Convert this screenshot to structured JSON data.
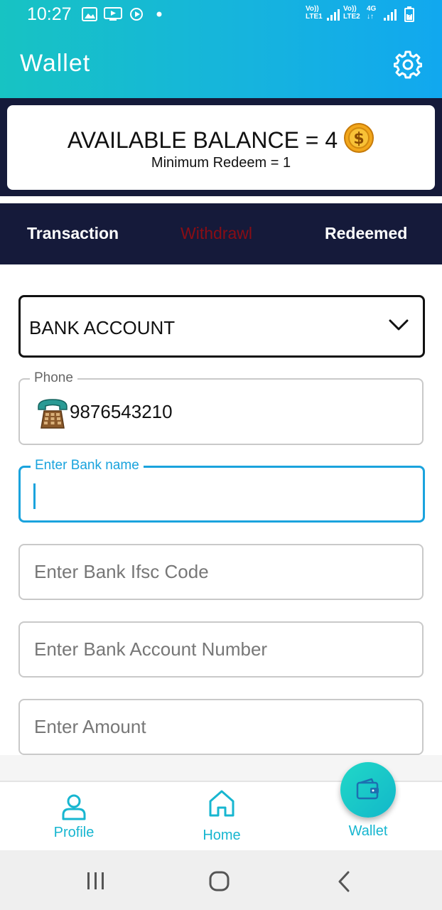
{
  "status_bar": {
    "time": "10:27",
    "net1": [
      "Vo))",
      "LTE1"
    ],
    "net2": [
      "Vo))",
      "LTE2"
    ],
    "net3": [
      "4G",
      "↓↑"
    ]
  },
  "header": {
    "title": "Wallet",
    "settings_icon": "gear-icon"
  },
  "balance": {
    "label": "AVAILABLE BALANCE = 4",
    "coin_icon": "dollar-coin-icon",
    "min_redeem": "Minimum Redeem = 1"
  },
  "tabs": [
    {
      "label": "Transaction",
      "active": false
    },
    {
      "label": "Withdrawl",
      "active": true
    },
    {
      "label": "Redeemed",
      "active": false
    }
  ],
  "form": {
    "method": {
      "selected": "BANK ACCOUNT"
    },
    "phone": {
      "label": "Phone",
      "value": "9876543210"
    },
    "bank_name": {
      "label": "Enter Bank name",
      "value": ""
    },
    "ifsc": {
      "placeholder": "Enter Bank Ifsc Code"
    },
    "account_number": {
      "placeholder": "Enter Bank Account Number"
    },
    "amount": {
      "placeholder": "Enter Amount"
    }
  },
  "bottom_nav": [
    {
      "label": "Profile",
      "icon": "person-icon"
    },
    {
      "label": "Home",
      "icon": "home-icon"
    },
    {
      "label": "Wallet",
      "icon": "wallet-icon",
      "active": true
    }
  ],
  "colors": {
    "header_start": "#17c3c3",
    "header_end": "#11a8ef",
    "navy": "#151a3a",
    "active_tab": "#8a0d15",
    "accent": "#1aa3dd",
    "nav_text": "#17b6d0"
  }
}
